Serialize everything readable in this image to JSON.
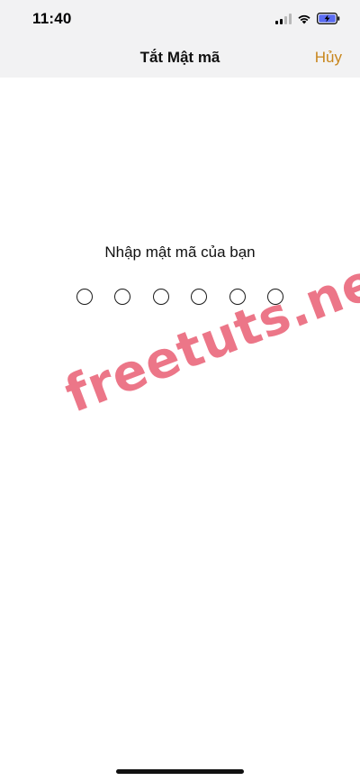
{
  "status_bar": {
    "time": "11:40",
    "icons": [
      "cellular-signal-icon",
      "wifi-icon",
      "battery-charging-icon"
    ]
  },
  "nav": {
    "title": "Tắt Mật mã",
    "cancel_label": "Hủy"
  },
  "passcode": {
    "prompt": "Nhập mật mã của bạn",
    "digit_count": 6,
    "entered_count": 0
  },
  "watermark": {
    "text": "freetuts.net"
  },
  "colors": {
    "accent": "#c8861c",
    "header_bg": "#f2f2f3",
    "watermark": "#e8586e"
  }
}
